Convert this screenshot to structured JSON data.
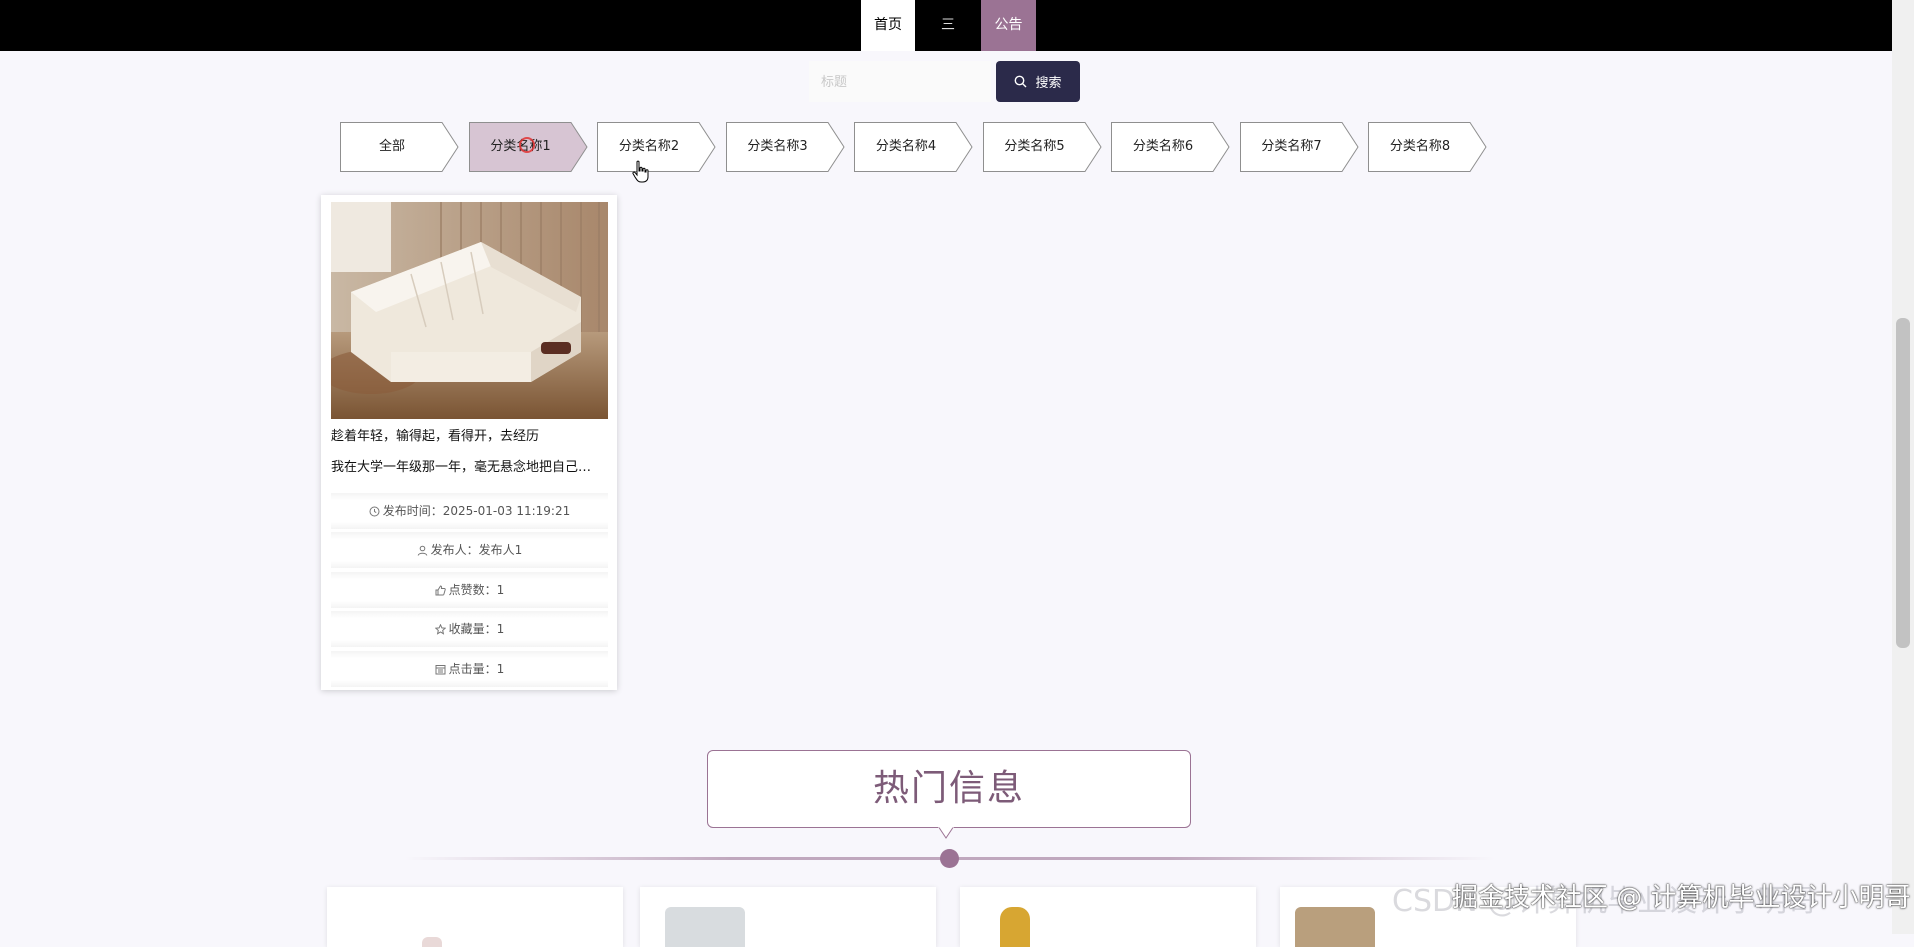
{
  "nav": {
    "home": "首页",
    "menu": "三",
    "notice": "公告"
  },
  "search": {
    "placeholder": "标题",
    "button_label": "搜索"
  },
  "categories": [
    {
      "label": "全部",
      "active": false
    },
    {
      "label": "分类名称1",
      "active": true
    },
    {
      "label": "分类名称2",
      "active": false
    },
    {
      "label": "分类名称3",
      "active": false
    },
    {
      "label": "分类名称4",
      "active": false
    },
    {
      "label": "分类名称5",
      "active": false
    },
    {
      "label": "分类名称6",
      "active": false
    },
    {
      "label": "分类名称7",
      "active": false
    },
    {
      "label": "分类名称8",
      "active": false
    }
  ],
  "card": {
    "title": "趁着年轻，输得起，看得开，去经历",
    "excerpt": "我在大学一年级那一年，毫无悬念地把自己…",
    "meta": [
      {
        "icon": "clock-icon",
        "label": "发布时间：2025-01-03 11:19:21"
      },
      {
        "icon": "user-icon",
        "label": "发布人：发布人1"
      },
      {
        "icon": "thumbs-up-icon",
        "label": "点赞数：1"
      },
      {
        "icon": "star-icon",
        "label": "收藏量：1"
      },
      {
        "icon": "calendar-icon",
        "label": "点击量：1"
      }
    ]
  },
  "hot": {
    "title": "热门信息"
  },
  "watermark": "掘金技术社区 @ 计算机毕业设计小明哥",
  "watermark_bg": "CSDN @计算机毕业设计小明哥",
  "colors": {
    "accent": "#9b7394",
    "search_button": "#2b2a4a",
    "topbar": "#000000"
  }
}
